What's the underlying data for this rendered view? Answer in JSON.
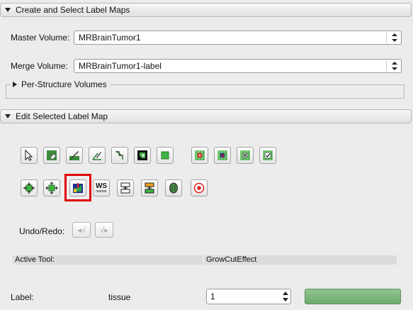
{
  "sections": {
    "create": {
      "title": "Create and Select Label Maps",
      "expanded": true
    },
    "per_structure": {
      "title": "Per-Structure Volumes",
      "expanded": false
    },
    "edit": {
      "title": "Edit Selected Label Map",
      "expanded": true
    }
  },
  "master_volume": {
    "label": "Master Volume:",
    "value": "MRBrainTumor1"
  },
  "merge_volume": {
    "label": "Merge Volume:",
    "value": "MRBrainTumor1-label"
  },
  "tools_row1": [
    {
      "icon": "pointer-arrow-icon"
    },
    {
      "icon": "erase-label-icon"
    },
    {
      "icon": "paint-brush-icon"
    },
    {
      "icon": "draw-pencil-icon"
    },
    {
      "icon": "level-tracing-icon"
    },
    {
      "icon": "image-threshold-icon"
    },
    {
      "icon": "rectangle-icon"
    },
    {
      "icon": "identify-islands-icon"
    },
    {
      "icon": "change-island-icon"
    },
    {
      "icon": "remove-islands-icon"
    },
    {
      "icon": "save-island-icon"
    }
  ],
  "tools_row2": [
    {
      "icon": "erode-label-icon"
    },
    {
      "icon": "dilate-label-icon"
    },
    {
      "icon": "grow-cut-icon",
      "selected": true
    },
    {
      "icon": "watershed-icon",
      "text_main": "WS",
      "text_sub": "marker"
    },
    {
      "icon": "change-label-icon"
    },
    {
      "icon": "fast-marching-icon"
    },
    {
      "icon": "make-model-icon"
    },
    {
      "icon": "target-icon"
    }
  ],
  "undo_redo": {
    "label": "Undo/Redo:"
  },
  "active_tool": {
    "label": "Active Tool:",
    "value": "GrowCutEffect"
  },
  "label_row": {
    "label": "Label:",
    "name": "tissue",
    "value": "1",
    "color": "#7dbb7d"
  },
  "colors": {
    "highlight": "#e00000",
    "label_color": "#7dbb7d"
  }
}
